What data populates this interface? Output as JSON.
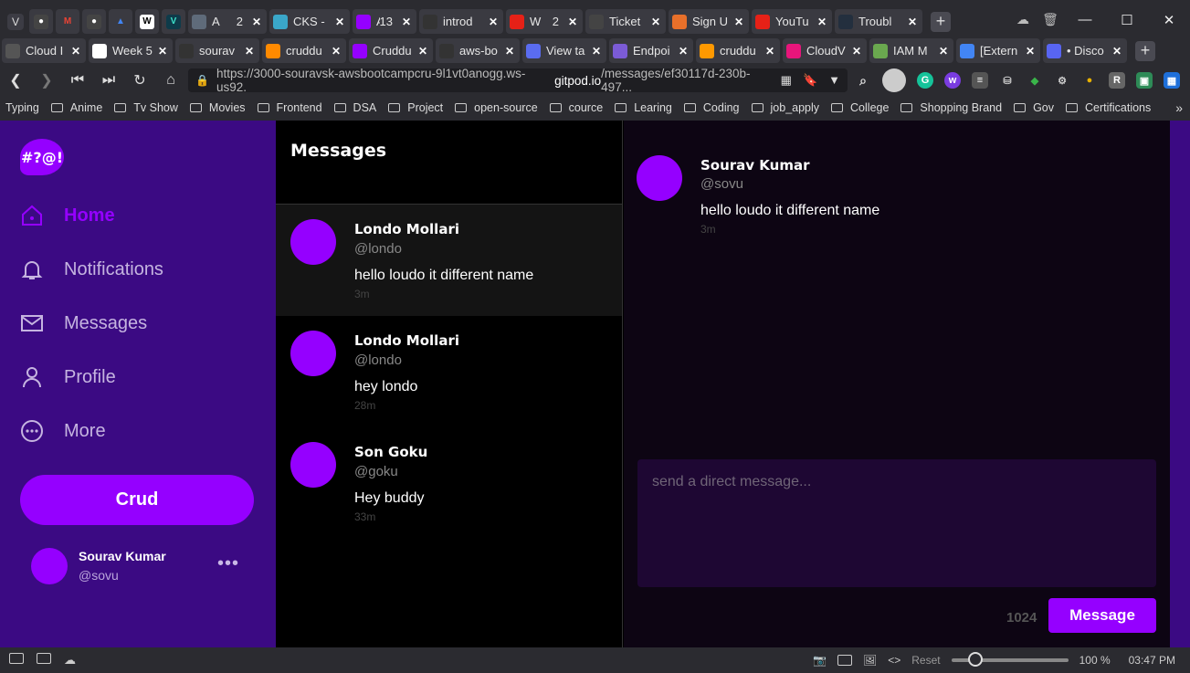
{
  "browser": {
    "tabs_row1": [
      {
        "label": "A",
        "count": "2",
        "icon": "aws-icon",
        "color": "#5f6b7a"
      },
      {
        "label": "CKS -",
        "icon": "cloud-icon",
        "color": "#3aa7c9"
      },
      {
        "label": "A",
        "count": "13",
        "icon": "app-icon",
        "color": "#9500ff"
      },
      {
        "label": "introd",
        "icon": "github-icon",
        "color": "#333333"
      },
      {
        "label": "W",
        "count": "2",
        "icon": "youtube-icon",
        "color": "#e62117"
      },
      {
        "label": "Ticket",
        "icon": "ticket-icon",
        "color": "#444444"
      },
      {
        "label": "Sign U",
        "icon": "sign-icon",
        "color": "#e8702a"
      },
      {
        "label": "YouTu",
        "icon": "youtube-icon",
        "color": "#e62117"
      },
      {
        "label": "Troubl",
        "icon": "aws-icon",
        "color": "#232f3e"
      }
    ],
    "tabs_row2": [
      {
        "label": "Cloud I",
        "icon": "page-icon",
        "color": "#555555"
      },
      {
        "label": "Week 5",
        "icon": "notion-icon",
        "color": "#ffffff"
      },
      {
        "label": "sourav",
        "icon": "github-icon",
        "color": "#333333"
      },
      {
        "label": "cruddu",
        "icon": "gitpod-icon",
        "color": "#ff8a00"
      },
      {
        "label": "Cruddu",
        "icon": "app-icon",
        "color": "#9500ff"
      },
      {
        "label": "aws-bo",
        "icon": "github-icon",
        "color": "#333333"
      },
      {
        "label": "View ta",
        "icon": "table-icon",
        "color": "#5a6cf0"
      },
      {
        "label": "Endpoi",
        "icon": "endpoint-icon",
        "color": "#7b5bd6"
      },
      {
        "label": "cruddu",
        "icon": "lambda-icon",
        "color": "#ff9900"
      },
      {
        "label": "CloudV",
        "icon": "cloudwatch-icon",
        "color": "#e7157b"
      },
      {
        "label": "IAM M",
        "icon": "key-icon",
        "color": "#6aa84f"
      },
      {
        "label": "[Extern",
        "icon": "docs-icon",
        "color": "#4285f4"
      },
      {
        "label": "• Disco",
        "icon": "discord-icon",
        "color": "#5865f2"
      }
    ],
    "url_prefix": "https://3000-souravsk-awsbootcampcru-9l1vt0anogg.ws-us92.",
    "url_domain": "gitpod.io",
    "url_suffix": "/messages/ef30117d-230b-497...",
    "bookmarks": [
      "Typing",
      "Anime",
      "Tv Show",
      "Movies",
      "Frontend",
      "DSA",
      "Project",
      "open-source",
      "cource",
      "Learing",
      "Coding",
      "job_apply",
      "College",
      "Shopping Brand",
      "Gov",
      "Certifications"
    ],
    "status": {
      "reset_label": "Reset",
      "zoom": "100 %",
      "time": "03:47 PM"
    }
  },
  "app": {
    "logo_text": "#?@!",
    "nav": [
      {
        "label": "Home",
        "icon": "home-icon",
        "active": true
      },
      {
        "label": "Notifications",
        "icon": "bell-icon",
        "active": false
      },
      {
        "label": "Messages",
        "icon": "envelope-icon",
        "active": false
      },
      {
        "label": "Profile",
        "icon": "user-icon",
        "active": false
      },
      {
        "label": "More",
        "icon": "more-icon",
        "active": false
      }
    ],
    "crud_label": "Crud",
    "current_user": {
      "name": "Sourav Kumar",
      "handle": "@sovu",
      "more": "..."
    },
    "groups_title": "Messages",
    "conversations": [
      {
        "name": "Londo Mollari",
        "handle": "@londo",
        "message": "hello loudo it different name",
        "time": "3m",
        "selected": true
      },
      {
        "name": "Londo Mollari",
        "handle": "@londo",
        "message": "hey londo",
        "time": "28m",
        "selected": false
      },
      {
        "name": "Son Goku",
        "handle": "@goku",
        "message": "Hey buddy",
        "time": "33m",
        "selected": false
      }
    ],
    "thread": {
      "message": {
        "name": "Sourav Kumar",
        "handle": "@sovu",
        "text": "hello loudo it different name",
        "time": "3m"
      },
      "input_placeholder": "send a direct message...",
      "counter": "1024",
      "send_label": "Message"
    },
    "colors": {
      "accent": "#9500ff",
      "sidebar_bg": "#3b0a83",
      "thread_bg": "#0d0513",
      "input_bg": "#1e0733"
    }
  }
}
